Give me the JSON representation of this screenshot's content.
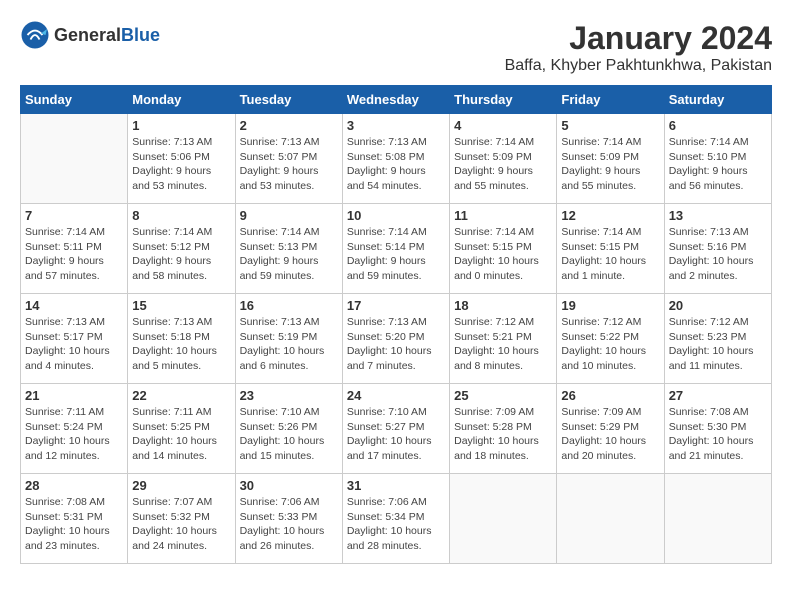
{
  "header": {
    "logo_general": "General",
    "logo_blue": "Blue",
    "month_title": "January 2024",
    "location": "Baffa, Khyber Pakhtunkhwa, Pakistan"
  },
  "weekdays": [
    "Sunday",
    "Monday",
    "Tuesday",
    "Wednesday",
    "Thursday",
    "Friday",
    "Saturday"
  ],
  "weeks": [
    [
      {
        "day": "",
        "info": ""
      },
      {
        "day": "1",
        "info": "Sunrise: 7:13 AM\nSunset: 5:06 PM\nDaylight: 9 hours\nand 53 minutes."
      },
      {
        "day": "2",
        "info": "Sunrise: 7:13 AM\nSunset: 5:07 PM\nDaylight: 9 hours\nand 53 minutes."
      },
      {
        "day": "3",
        "info": "Sunrise: 7:13 AM\nSunset: 5:08 PM\nDaylight: 9 hours\nand 54 minutes."
      },
      {
        "day": "4",
        "info": "Sunrise: 7:14 AM\nSunset: 5:09 PM\nDaylight: 9 hours\nand 55 minutes."
      },
      {
        "day": "5",
        "info": "Sunrise: 7:14 AM\nSunset: 5:09 PM\nDaylight: 9 hours\nand 55 minutes."
      },
      {
        "day": "6",
        "info": "Sunrise: 7:14 AM\nSunset: 5:10 PM\nDaylight: 9 hours\nand 56 minutes."
      }
    ],
    [
      {
        "day": "7",
        "info": "Sunrise: 7:14 AM\nSunset: 5:11 PM\nDaylight: 9 hours\nand 57 minutes."
      },
      {
        "day": "8",
        "info": "Sunrise: 7:14 AM\nSunset: 5:12 PM\nDaylight: 9 hours\nand 58 minutes."
      },
      {
        "day": "9",
        "info": "Sunrise: 7:14 AM\nSunset: 5:13 PM\nDaylight: 9 hours\nand 59 minutes."
      },
      {
        "day": "10",
        "info": "Sunrise: 7:14 AM\nSunset: 5:14 PM\nDaylight: 9 hours\nand 59 minutes."
      },
      {
        "day": "11",
        "info": "Sunrise: 7:14 AM\nSunset: 5:15 PM\nDaylight: 10 hours\nand 0 minutes."
      },
      {
        "day": "12",
        "info": "Sunrise: 7:14 AM\nSunset: 5:15 PM\nDaylight: 10 hours\nand 1 minute."
      },
      {
        "day": "13",
        "info": "Sunrise: 7:13 AM\nSunset: 5:16 PM\nDaylight: 10 hours\nand 2 minutes."
      }
    ],
    [
      {
        "day": "14",
        "info": "Sunrise: 7:13 AM\nSunset: 5:17 PM\nDaylight: 10 hours\nand 4 minutes."
      },
      {
        "day": "15",
        "info": "Sunrise: 7:13 AM\nSunset: 5:18 PM\nDaylight: 10 hours\nand 5 minutes."
      },
      {
        "day": "16",
        "info": "Sunrise: 7:13 AM\nSunset: 5:19 PM\nDaylight: 10 hours\nand 6 minutes."
      },
      {
        "day": "17",
        "info": "Sunrise: 7:13 AM\nSunset: 5:20 PM\nDaylight: 10 hours\nand 7 minutes."
      },
      {
        "day": "18",
        "info": "Sunrise: 7:12 AM\nSunset: 5:21 PM\nDaylight: 10 hours\nand 8 minutes."
      },
      {
        "day": "19",
        "info": "Sunrise: 7:12 AM\nSunset: 5:22 PM\nDaylight: 10 hours\nand 10 minutes."
      },
      {
        "day": "20",
        "info": "Sunrise: 7:12 AM\nSunset: 5:23 PM\nDaylight: 10 hours\nand 11 minutes."
      }
    ],
    [
      {
        "day": "21",
        "info": "Sunrise: 7:11 AM\nSunset: 5:24 PM\nDaylight: 10 hours\nand 12 minutes."
      },
      {
        "day": "22",
        "info": "Sunrise: 7:11 AM\nSunset: 5:25 PM\nDaylight: 10 hours\nand 14 minutes."
      },
      {
        "day": "23",
        "info": "Sunrise: 7:10 AM\nSunset: 5:26 PM\nDaylight: 10 hours\nand 15 minutes."
      },
      {
        "day": "24",
        "info": "Sunrise: 7:10 AM\nSunset: 5:27 PM\nDaylight: 10 hours\nand 17 minutes."
      },
      {
        "day": "25",
        "info": "Sunrise: 7:09 AM\nSunset: 5:28 PM\nDaylight: 10 hours\nand 18 minutes."
      },
      {
        "day": "26",
        "info": "Sunrise: 7:09 AM\nSunset: 5:29 PM\nDaylight: 10 hours\nand 20 minutes."
      },
      {
        "day": "27",
        "info": "Sunrise: 7:08 AM\nSunset: 5:30 PM\nDaylight: 10 hours\nand 21 minutes."
      }
    ],
    [
      {
        "day": "28",
        "info": "Sunrise: 7:08 AM\nSunset: 5:31 PM\nDaylight: 10 hours\nand 23 minutes."
      },
      {
        "day": "29",
        "info": "Sunrise: 7:07 AM\nSunset: 5:32 PM\nDaylight: 10 hours\nand 24 minutes."
      },
      {
        "day": "30",
        "info": "Sunrise: 7:06 AM\nSunset: 5:33 PM\nDaylight: 10 hours\nand 26 minutes."
      },
      {
        "day": "31",
        "info": "Sunrise: 7:06 AM\nSunset: 5:34 PM\nDaylight: 10 hours\nand 28 minutes."
      },
      {
        "day": "",
        "info": ""
      },
      {
        "day": "",
        "info": ""
      },
      {
        "day": "",
        "info": ""
      }
    ]
  ]
}
